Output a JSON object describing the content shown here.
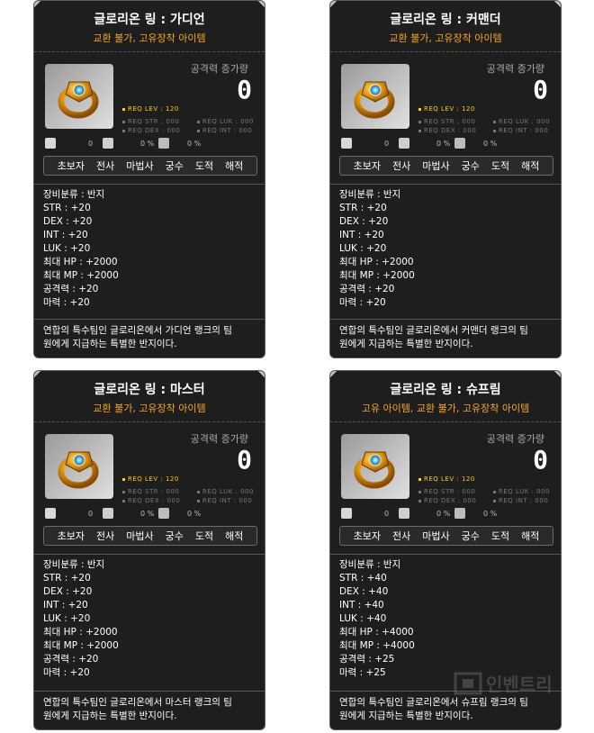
{
  "common": {
    "atk_label": "공격력 증가량",
    "atk_value": "0",
    "req_lev": "REQ LEV : 120",
    "req_str": "REQ STR : 000",
    "req_luk": "REQ LUK : 000",
    "req_dex": "REQ DEX : 000",
    "req_int": "REQ INT : 000",
    "slot_values": [
      "0",
      "0 %",
      "0 %"
    ],
    "jobs": [
      "초보자",
      "전사",
      "마법사",
      "궁수",
      "도적",
      "해적"
    ],
    "category": "장비분류 : 반지"
  },
  "cards": [
    {
      "title": "글로리온 링 : 가디언",
      "subtitle": "교환 불가, 고유장착 아이템",
      "stats": [
        "STR : +20",
        "DEX : +20",
        "INT : +20",
        "LUK : +20",
        "최대 HP : +2000",
        "최대 MP : +2000",
        "공격력 : +20",
        "마력 : +20"
      ],
      "desc1": "연합의 특수팀인 글로리온에서 가디언 랭크의 팀",
      "desc2": "원에게 지급하는 특별한 반지이다."
    },
    {
      "title": "글로리온 링 : 커맨더",
      "subtitle": "교환 불가, 고유장착 아이템",
      "stats": [
        "STR : +20",
        "DEX : +20",
        "INT : +20",
        "LUK : +20",
        "최대 HP : +2000",
        "최대 MP : +2000",
        "공격력 : +20",
        "마력 : +20"
      ],
      "desc1": "연합의 특수팀인 글로리온에서 커맨더 랭크의 팀",
      "desc2": "원에게 지급하는 특별한 반지이다."
    },
    {
      "title": "글로리온 링 : 마스터",
      "subtitle": "교환 불가, 고유장착 아이템",
      "stats": [
        "STR : +20",
        "DEX : +20",
        "INT : +20",
        "LUK : +20",
        "최대 HP : +2000",
        "최대 MP : +2000",
        "공격력 : +20",
        "마력 : +20"
      ],
      "desc1": "연합의 특수팀인 글로리온에서 마스터 랭크의 팀",
      "desc2": "원에게 지급하는 특별한 반지이다."
    },
    {
      "title": "글로리온 링 : 슈프림",
      "subtitle": "고유 아이템, 교환 불가, 고유장착 아이템",
      "stats": [
        "STR : +40",
        "DEX : +40",
        "INT : +40",
        "LUK : +40",
        "최대 HP : +4000",
        "최대 MP : +4000",
        "공격력 : +25",
        "마력 : +25"
      ],
      "desc1": "연합의 특수팀인 글로리온에서 슈프림 랭크의 팀",
      "desc2": "원에게 지급하는 특별한 반지이다."
    }
  ],
  "colors": {
    "bg": "#1e1e1f",
    "subtitle": "#f5a623",
    "req_lev": "#ffcc00",
    "text": "#ffffff"
  },
  "watermark_text": "인벤트리"
}
